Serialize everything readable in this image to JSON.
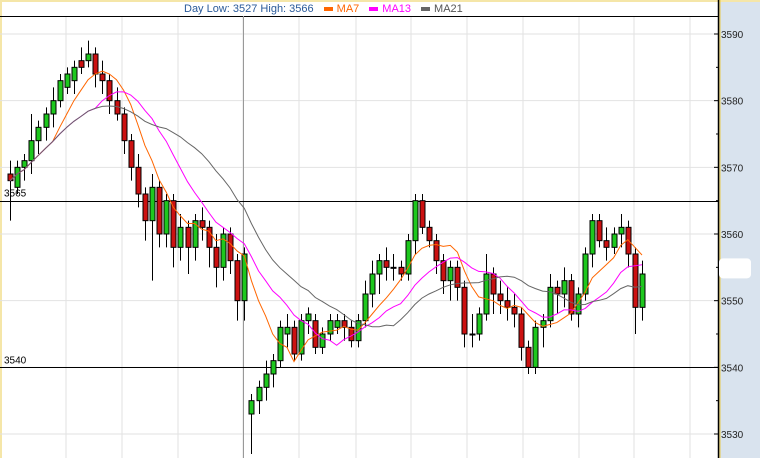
{
  "header": {
    "day_range": "Day Low: 3527  High: 3566",
    "legend": [
      {
        "label": "MA7",
        "color": "#ff6600",
        "period": 7
      },
      {
        "label": "MA13",
        "color": "#ff00ff",
        "period": 13
      },
      {
        "label": "MA21",
        "color": "#666666",
        "period": 21
      }
    ]
  },
  "chart_data": {
    "type": "candlestick",
    "title": "",
    "ylim": [
      3526,
      3592
    ],
    "y_ticks": [
      "3590",
      "3580",
      "3570",
      "3560",
      "3550",
      "3540",
      "3530"
    ],
    "y_tick_values": [
      3590,
      3580,
      3570,
      3560,
      3550,
      3540,
      3530
    ],
    "reference_lines": [
      {
        "value": 3565,
        "label": "3565"
      },
      {
        "value": 3540,
        "label": "3540"
      }
    ],
    "day_low": 3527,
    "day_high": 3566,
    "colors": {
      "up": "#1ec81e",
      "down": "#cc1111",
      "grid": "#e2e2e2",
      "axis_panel": "#d9e3ee"
    },
    "candles_ohlc": [
      [
        3569,
        3571,
        3562,
        3568
      ],
      [
        3567,
        3571,
        3566,
        3570
      ],
      [
        3570,
        3572,
        3568,
        3571
      ],
      [
        3571,
        3578,
        3569,
        3574
      ],
      [
        3574,
        3577,
        3572,
        3576
      ],
      [
        3576,
        3579,
        3574,
        3578
      ],
      [
        3578,
        3582,
        3576,
        3580
      ],
      [
        3580,
        3584,
        3579,
        3583
      ],
      [
        3582,
        3585,
        3581,
        3584
      ],
      [
        3583,
        3586,
        3581,
        3585
      ],
      [
        3586,
        3588,
        3584,
        3585
      ],
      [
        3586,
        3589,
        3585,
        3587
      ],
      [
        3587,
        3588,
        3582,
        3584
      ],
      [
        3584,
        3586,
        3581,
        3583
      ],
      [
        3583,
        3584,
        3578,
        3580
      ],
      [
        3580,
        3582,
        3577,
        3578
      ],
      [
        3578,
        3579,
        3572,
        3574
      ],
      [
        3574,
        3575,
        3568,
        3570
      ],
      [
        3570,
        3572,
        3564,
        3566
      ],
      [
        3566,
        3567,
        3559,
        3562
      ],
      [
        3562,
        3569,
        3553,
        3567
      ],
      [
        3567,
        3568,
        3558,
        3560
      ],
      [
        3560,
        3566,
        3558,
        3565
      ],
      [
        3565,
        3566,
        3555,
        3558
      ],
      [
        3558,
        3563,
        3556,
        3561
      ],
      [
        3561,
        3562,
        3554,
        3558
      ],
      [
        3558,
        3563,
        3556,
        3562
      ],
      [
        3562,
        3564,
        3559,
        3561
      ],
      [
        3561,
        3562,
        3555,
        3558
      ],
      [
        3558,
        3560,
        3552,
        3555
      ],
      [
        3555,
        3561,
        3553,
        3560
      ],
      [
        3560,
        3561,
        3554,
        3556
      ],
      [
        3556,
        3557,
        3547,
        3550
      ],
      [
        3550,
        3558,
        3547,
        3557
      ],
      [
        3533,
        3536,
        3527,
        3535
      ],
      [
        3535,
        3538,
        3533,
        3537
      ],
      [
        3537,
        3541,
        3535,
        3539
      ],
      [
        3539,
        3542,
        3537,
        3541
      ],
      [
        3541,
        3547,
        3540,
        3546
      ],
      [
        3545,
        3548,
        3543,
        3546
      ],
      [
        3546,
        3547,
        3541,
        3542
      ],
      [
        3542,
        3548,
        3541,
        3547
      ],
      [
        3547,
        3549,
        3545,
        3548
      ],
      [
        3547,
        3548,
        3542,
        3543
      ],
      [
        3543,
        3546,
        3542,
        3545
      ],
      [
        3545,
        3548,
        3544,
        3547
      ],
      [
        3546,
        3548,
        3545,
        3547
      ],
      [
        3547,
        3548,
        3544,
        3546
      ],
      [
        3546,
        3547,
        3543,
        3544
      ],
      [
        3544,
        3548,
        3543,
        3547
      ],
      [
        3547,
        3553,
        3546,
        3551
      ],
      [
        3551,
        3556,
        3549,
        3554
      ],
      [
        3554,
        3557,
        3551,
        3556
      ],
      [
        3556,
        3558,
        3553,
        3555
      ],
      [
        3555,
        3557,
        3553,
        3555
      ],
      [
        3555,
        3556,
        3553,
        3554
      ],
      [
        3554,
        3560,
        3553,
        3559
      ],
      [
        3559,
        3566,
        3557,
        3565
      ],
      [
        3565,
        3566,
        3560,
        3561
      ],
      [
        3561,
        3562,
        3558,
        3559
      ],
      [
        3559,
        3560,
        3554,
        3556
      ],
      [
        3556,
        3557,
        3551,
        3553
      ],
      [
        3553,
        3556,
        3550,
        3555
      ],
      [
        3555,
        3556,
        3550,
        3552
      ],
      [
        3552,
        3553,
        3543,
        3545
      ],
      [
        3545,
        3548,
        3543,
        3545
      ],
      [
        3545,
        3549,
        3544,
        3548
      ],
      [
        3548,
        3557,
        3547,
        3554
      ],
      [
        3554,
        3555,
        3548,
        3551
      ],
      [
        3551,
        3553,
        3548,
        3550
      ],
      [
        3550,
        3552,
        3547,
        3549
      ],
      [
        3549,
        3551,
        3546,
        3548
      ],
      [
        3548,
        3549,
        3541,
        3543
      ],
      [
        3543,
        3544,
        3539,
        3540
      ],
      [
        3540,
        3547,
        3539,
        3546
      ],
      [
        3546,
        3548,
        3543,
        3547
      ],
      [
        3547,
        3554,
        3546,
        3552
      ],
      [
        3552,
        3553,
        3548,
        3551
      ],
      [
        3551,
        3555,
        3549,
        3553
      ],
      [
        3553,
        3554,
        3547,
        3548
      ],
      [
        3548,
        3552,
        3546,
        3551
      ],
      [
        3551,
        3558,
        3550,
        3557
      ],
      [
        3557,
        3563,
        3555,
        3562
      ],
      [
        3562,
        3563,
        3558,
        3559
      ],
      [
        3559,
        3561,
        3556,
        3558
      ],
      [
        3558,
        3561,
        3557,
        3560
      ],
      [
        3560,
        3563,
        3558,
        3561
      ],
      [
        3561,
        3562,
        3555,
        3557
      ],
      [
        3557,
        3558,
        3545,
        3549
      ],
      [
        3549,
        3556,
        3547,
        3554
      ]
    ]
  }
}
